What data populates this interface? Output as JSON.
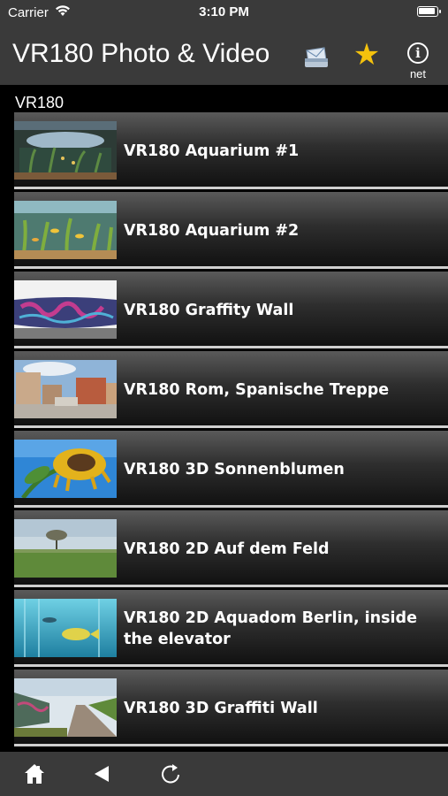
{
  "status_bar": {
    "carrier": "Carrier",
    "time": "3:10 PM"
  },
  "nav": {
    "title": "VR180 Photo & Video",
    "info_label": "net",
    "star_color": "#f4c20d"
  },
  "section": {
    "title": "VR180"
  },
  "items": [
    {
      "label": "VR180 Aquarium #1"
    },
    {
      "label": "VR180 Aquarium #2"
    },
    {
      "label": "VR180 Graffity Wall"
    },
    {
      "label": "VR180 Rom, Spanische Treppe"
    },
    {
      "label": "VR180 3D Sonnenblumen"
    },
    {
      "label": "VR180 2D Auf dem Feld"
    },
    {
      "label": "VR180 2D Aquadom Berlin, inside the elevator"
    },
    {
      "label": "VR180 3D Graffiti Wall"
    }
  ],
  "toolbar": {
    "icons": [
      "home-icon",
      "back-icon",
      "reload-icon"
    ]
  }
}
